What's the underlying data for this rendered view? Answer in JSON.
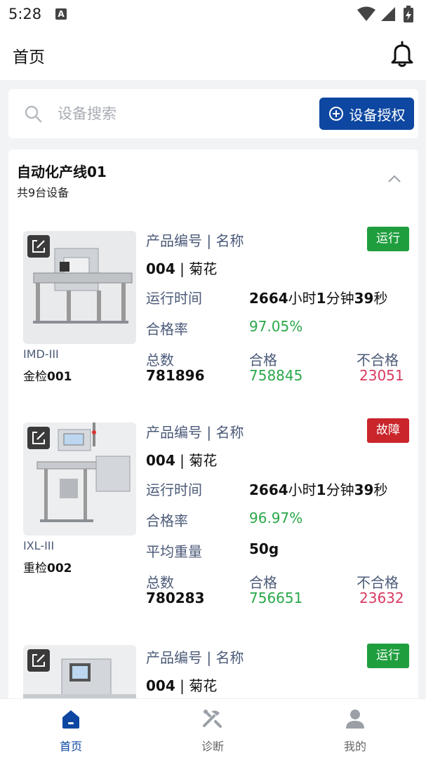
{
  "status_bar": {
    "time": "5:28",
    "a_badge": "A"
  },
  "header": {
    "title": "首页"
  },
  "search": {
    "placeholder": "设备搜索",
    "auth_label": "设备授权"
  },
  "group": {
    "title": "自动化产线01",
    "subtitle": "共9台设备"
  },
  "labels": {
    "product": "产品编号 | 名称",
    "runtime": "运行时间",
    "pass_rate": "合格率",
    "avg_weight": "平均重量",
    "total": "总数",
    "pass": "合格",
    "fail": "不合格"
  },
  "devices": [
    {
      "model": "IMD-III",
      "name_prefix": "金检",
      "name_num": "001",
      "status": "运行",
      "product": "004 | 菊花",
      "product_code": "004",
      "product_name": "菊花",
      "runtime_h": "2664",
      "runtime_m": "1",
      "runtime_s": "39",
      "unit_h": "小时",
      "unit_m": "分钟",
      "unit_s": "秒",
      "pass_rate": "97.05%",
      "total": "781896",
      "pass": "758845",
      "fail": "23051"
    },
    {
      "model": "IXL-III",
      "name_prefix": "重检",
      "name_num": "002",
      "status": "故障",
      "product_code": "004",
      "product_name": "菊花",
      "runtime_h": "2664",
      "runtime_m": "1",
      "runtime_s": "39",
      "unit_h": "小时",
      "unit_m": "分钟",
      "unit_s": "秒",
      "pass_rate": "96.97%",
      "avg_weight": "50g",
      "total": "780283",
      "pass": "756651",
      "fail": "23632"
    },
    {
      "status": "运行",
      "product_code": "004",
      "product_name": "菊花"
    }
  ],
  "nav": [
    {
      "label": "首页",
      "icon": "home-icon",
      "active": true
    },
    {
      "label": "诊断",
      "icon": "tools-icon",
      "active": false
    },
    {
      "label": "我的",
      "icon": "user-icon",
      "active": false
    }
  ],
  "colors": {
    "primary": "#0d47a1",
    "run": "#1f9e3e",
    "fault": "#c9252b",
    "pass": "#2aa84a",
    "fail": "#d93a5f"
  }
}
